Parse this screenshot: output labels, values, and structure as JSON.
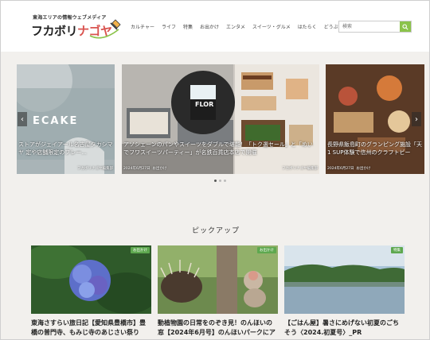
{
  "header": {
    "tagline": "東海エリアの情報ウェブメディア",
    "logo_prefix": "フカボリ",
    "logo_accent": "ナゴヤ",
    "nav": [
      "カルチャー",
      "ライフ",
      "特集",
      "お出かけ",
      "エンタメ",
      "スイーツ・グルメ",
      "はたらく",
      "どうぶつ"
    ],
    "search_placeholder": "検索"
  },
  "slider": {
    "left": {
      "overlay_text": "ECAKE",
      "caption": "ストアがジェイアール名古屋タカシマヤ 定や店舗限定のフレー...",
      "meta_left": "",
      "meta_right": "フカボリナゴヤ編集部"
    },
    "center": {
      "sign": "FLOR",
      "caption": "アソシェーンのパンやスイーツをダブルで堪能！「トク選セール」と「めいでフワスイーツパーティー」が名鉄百貨店本店で開催",
      "meta_date": "2024年6月27日",
      "meta_cat": "お出かけ",
      "meta_right": "フカボリナゴヤ編集部"
    },
    "right": {
      "caption": "長野県飯島町のグランピング施設「天 1 SUP体験で信州のクラフトビー",
      "meta_date": "2024年6月27日",
      "meta_cat": "お出かけ"
    },
    "dots": 3,
    "active_dot": 0
  },
  "pickup": {
    "title": "ピックアップ",
    "cards": [
      {
        "badge": "お出かけ",
        "title": "東海さすらい旅日記【愛知県豊橋市】豊橋の普門寺、もみじ寺のあじさい祭り"
      },
      {
        "badge": "お出かけ",
        "title": "動植物園の日常をのぞき見！のんほいの窓【2024年6月号】のんほいパークにア"
      },
      {
        "badge": "特集",
        "title": "【ごはん屋】暑さにめげない初夏のごちそう〈2024.初夏号〉_PR"
      }
    ]
  },
  "colors": {
    "accent_green": "#8bc34a",
    "badge_green": "#5ea84f",
    "logo_red": "#d9534f"
  }
}
